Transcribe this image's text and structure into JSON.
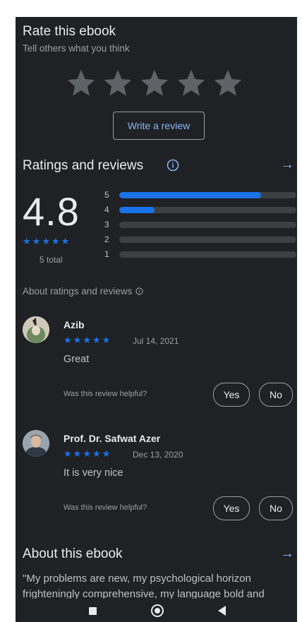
{
  "rate_section": {
    "title": "Rate this ebook",
    "subtitle": "Tell others what you think",
    "write_review": "Write a review",
    "empty_star_color": "#5f6368"
  },
  "ratings": {
    "title": "Ratings and reviews",
    "info_icon": "info-icon",
    "arrow_icon": "arrow-right-icon",
    "average": "4.8",
    "total": "5 total",
    "average_stars": 5,
    "bars": [
      {
        "label": "5",
        "fraction": 0.8
      },
      {
        "label": "4",
        "fraction": 0.2
      },
      {
        "label": "3",
        "fraction": 0
      },
      {
        "label": "2",
        "fraction": 0
      },
      {
        "label": "1",
        "fraction": 0
      }
    ],
    "about_link": "About ratings and reviews",
    "accent": "#1a73e8"
  },
  "reviews": [
    {
      "name": "Azib",
      "stars": 5,
      "date": "Jul 14, 2021",
      "text": "Great",
      "helpful_q": "Was this review helpful?",
      "yes": "Yes",
      "no": "No"
    },
    {
      "name": "Prof. Dr. Safwat Azer",
      "stars": 5,
      "date": "Dec 13, 2020",
      "text": "It is very nice",
      "helpful_q": "Was this review helpful?",
      "yes": "Yes",
      "no": "No"
    }
  ],
  "about": {
    "title": "About this ebook",
    "line1": "\"My problems are new, my psychological horizon",
    "line2": "frighteningly comprehensive, my language bold and"
  },
  "nav": {
    "square_icon": "recents-square-icon",
    "circle_icon": "home-circle-icon",
    "triangle_icon": "back-triangle-icon"
  }
}
